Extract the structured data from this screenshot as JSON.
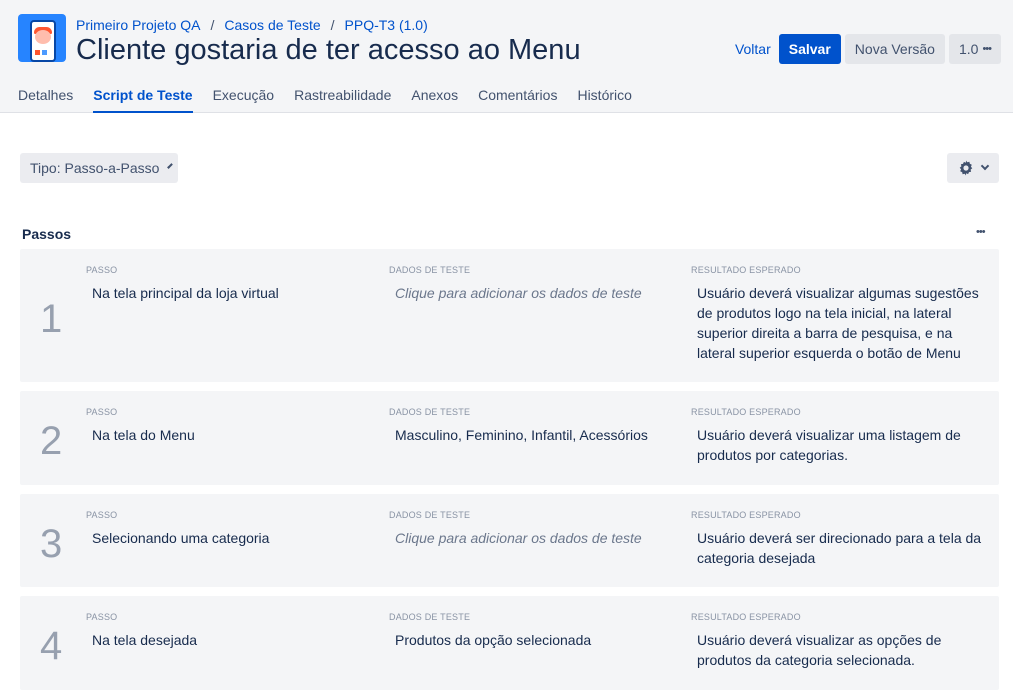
{
  "breadcrumb": {
    "project": "Primeiro Projeto QA",
    "section": "Casos de Teste",
    "item": "PPQ-T3 (1.0)"
  },
  "title": "Cliente gostaria de ter acesso ao Menu",
  "actions": {
    "back": "Voltar",
    "save": "Salvar",
    "new_version": "Nova Versão",
    "version": "1.0",
    "more": "•••"
  },
  "tabs": [
    {
      "label": "Detalhes"
    },
    {
      "label": "Script de Teste"
    },
    {
      "label": "Execução"
    },
    {
      "label": "Rastreabilidade"
    },
    {
      "label": "Anexos"
    },
    {
      "label": "Comentários"
    },
    {
      "label": "Histórico"
    }
  ],
  "active_tab": "Script de Teste",
  "type_select": {
    "value": "Tipo: Passo-a-Passo"
  },
  "section": {
    "title": "Passos",
    "more": "•••"
  },
  "columns": {
    "step": "PASSO",
    "data": "DADOS DE TESTE",
    "expected": "RESULTADO ESPERADO"
  },
  "steps": [
    {
      "number": "1",
      "step": "Na tela principal da loja virtual",
      "data": "Clique para adicionar os dados de teste",
      "data_is_placeholder": true,
      "expected": "Usuário deverá visualizar algumas sugestões de produtos logo na tela inicial, na lateral superior direita a barra de pesquisa, e na lateral superior esquerda o botão de Menu"
    },
    {
      "number": "2",
      "step": "Na tela do Menu",
      "data": "Masculino, Feminino, Infantil, Acessórios",
      "data_is_placeholder": false,
      "expected": "Usuário deverá visualizar uma listagem de produtos por categorias."
    },
    {
      "number": "3",
      "step": "Selecionando uma categoria",
      "data": "Clique para adicionar os dados de teste",
      "data_is_placeholder": true,
      "expected": "Usuário deverá ser direcionado para a tela da categoria desejada"
    },
    {
      "number": "4",
      "step": "Na tela desejada",
      "data": "Produtos da opção selecionada",
      "data_is_placeholder": false,
      "expected": "Usuário deverá visualizar as opções de produtos da categoria selecionada."
    }
  ],
  "icons": {
    "settings": "gear-icon",
    "dropdown": "chevron-down-icon",
    "more": "more-icon"
  },
  "colors": {
    "accent": "#0052cc",
    "header_bg": "#f4f5f7",
    "step_bg": "#f4f5f7"
  }
}
